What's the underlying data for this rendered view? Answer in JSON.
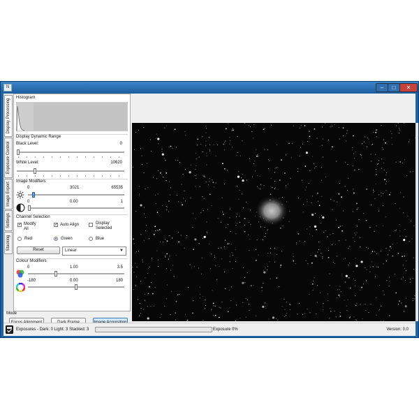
{
  "window": {
    "icon_text": "N",
    "min": "–",
    "max": "□",
    "close": "✕"
  },
  "tabs": [
    "Display Processing",
    "Exposure Control",
    "Image Export",
    "Settings",
    "Stacking"
  ],
  "histogram": {
    "title": "Histogram"
  },
  "dynamic_range": {
    "title": "Display Dynamic Range",
    "black_label": "Black Level:",
    "black_value": "0",
    "black_level": 0,
    "white_label": "White Level:",
    "white_value": "10620",
    "white_level": 0.162
  },
  "image_modifiers": {
    "title": "Image Modifiers",
    "brightness": {
      "icon": "sun-icon",
      "min": "0",
      "value": "3021",
      "max": "65535",
      "level": 0.046
    },
    "contrast": {
      "icon": "contrast-icon",
      "min": "0",
      "value": "0.00",
      "max": "1",
      "level": 0.0
    }
  },
  "channel": {
    "title": "Channel Selection",
    "modify_all": "Modify All",
    "modify_all_checked": true,
    "auto_align": "Auto Align",
    "auto_align_checked": true,
    "display_selected": "Display Selected",
    "display_selected_checked": false,
    "red": "Red",
    "green": "Green",
    "blue": "Blue",
    "selected": "Green",
    "reset": "Reset",
    "stretch": "Linear"
  },
  "colour": {
    "title": "Colour Modifiers",
    "saturation": {
      "icon": "rgb-circles-icon",
      "min": "0",
      "value": "1.00",
      "max": "3.5",
      "level": 0.286
    },
    "hue": {
      "icon": "colour-wheel-icon",
      "min": "-180",
      "value": "0.00",
      "max": "180",
      "level": 0.5
    }
  },
  "mode": {
    "title": "Mode",
    "focus": "Focus Alignment Framing",
    "dark": "Dark Frame Acquisition",
    "acquire": "Image Acquisition",
    "selected": "Image Acquisition"
  },
  "status": {
    "exposures": "Exposures - Dark: 0 Light: 3 Stacked: 3",
    "exposure_label": "Exposure 0%",
    "progress": 0,
    "version": "Version: 0.0",
    "device_icon": "camera-device-icon"
  },
  "colors": {
    "selected_mode": "#a8d4f4",
    "title_bar": "#1e5fa3",
    "slider_thumb_blue": "#5c9bd6"
  }
}
